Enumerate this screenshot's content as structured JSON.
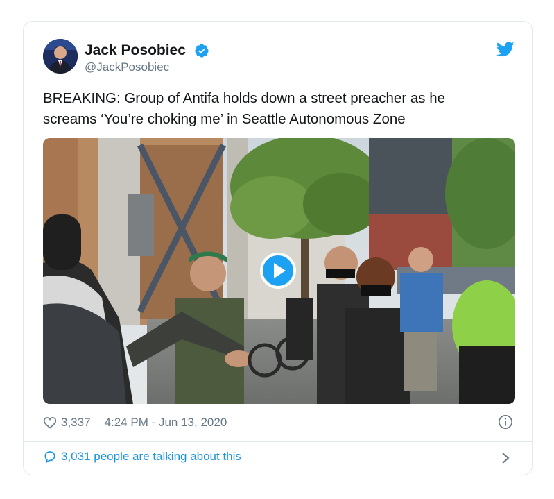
{
  "author": {
    "name": "Jack Posobiec",
    "handle": "@JackPosobiec"
  },
  "tweet": {
    "text": "BREAKING: Group of Antifa holds down a street preacher as he screams ‘You’re choking me’ in Seattle Autonomous Zone"
  },
  "meta": {
    "likes": "3,337",
    "timestamp": "4:24 PM - Jun 13, 2020"
  },
  "footer": {
    "conversation": "3,031 people are talking about this"
  },
  "colors": {
    "accent": "#1da1f2",
    "link": "#1b95e0",
    "muted": "#657786"
  },
  "icons": [
    "verified-badge-icon",
    "twitter-bird-icon",
    "play-icon",
    "heart-icon",
    "info-icon",
    "reply-icon",
    "chevron-right-icon"
  ]
}
